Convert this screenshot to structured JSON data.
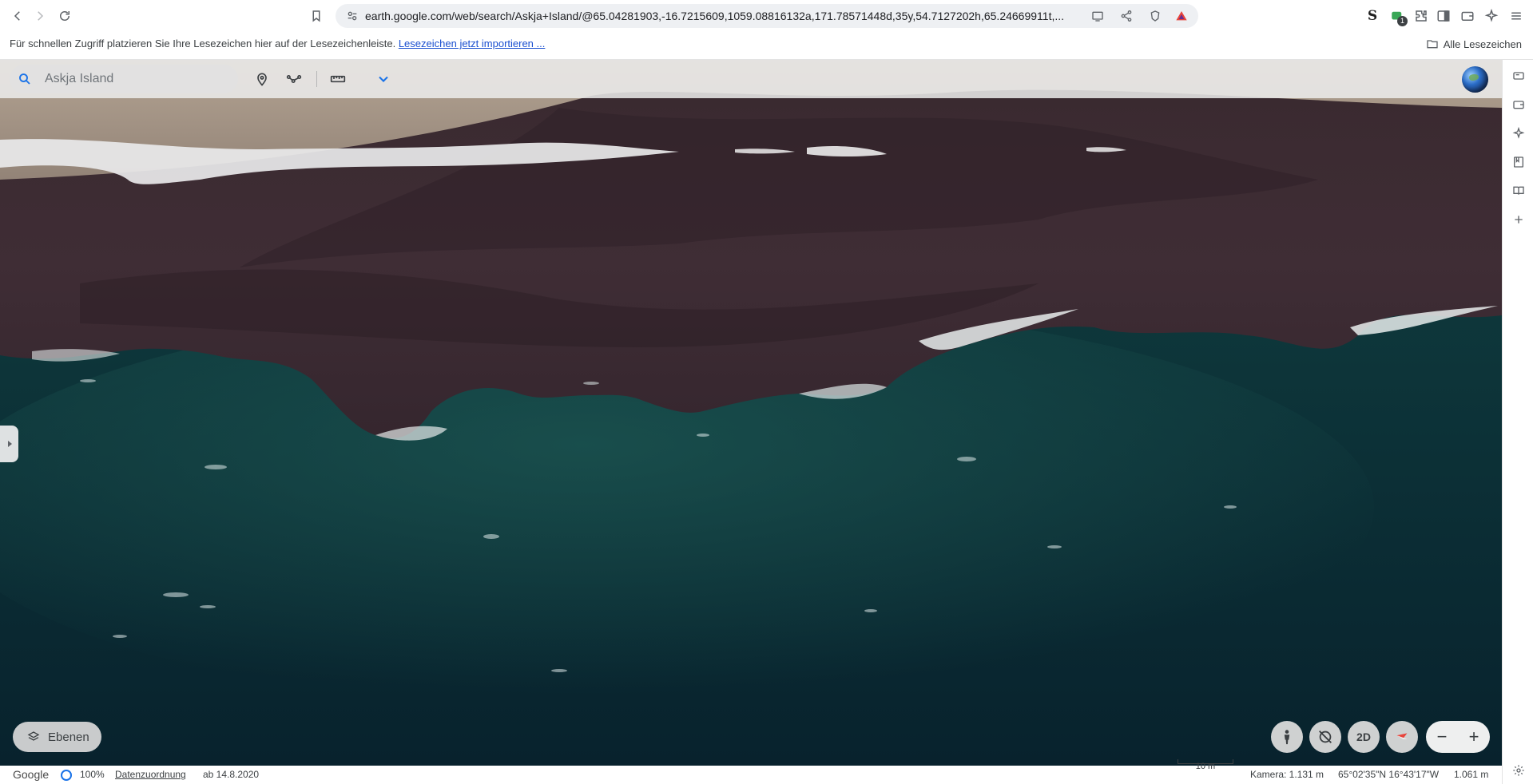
{
  "browser": {
    "url": "earth.google.com/web/search/Askja+Island/@65.04281903,-16.7215609,1059.08816132a,171.78571448d,35y,54.7127202h,65.24669911t,...",
    "bookmarks_bar": {
      "hint": "Für schnellen Zugriff platzieren Sie Ihre Lesezeichen hier auf der Lesezeichenleiste.",
      "import_link": "Lesezeichen jetzt importieren ...",
      "all_bookmarks": "Alle Lesezeichen"
    },
    "extension_badge": "1"
  },
  "earth": {
    "search": {
      "value": "",
      "placeholder": "Askja Island"
    },
    "layers_label": "Ebenen",
    "view_mode": "2D",
    "status": {
      "logo": "Google",
      "load_percent": "100%",
      "attribution": "Datenzuordnung",
      "imagery_date": "ab 14.8.2020",
      "scale": "10 m",
      "camera": "Kamera: 1.131 m",
      "coordinates": "65°02'35\"N 16°43'17\"W",
      "altitude": "1.061 m"
    }
  },
  "colors": {
    "accent": "#1a73e8",
    "lava": "#3d2b33",
    "lake": "#0f3a40",
    "ash": "#a9998a"
  }
}
